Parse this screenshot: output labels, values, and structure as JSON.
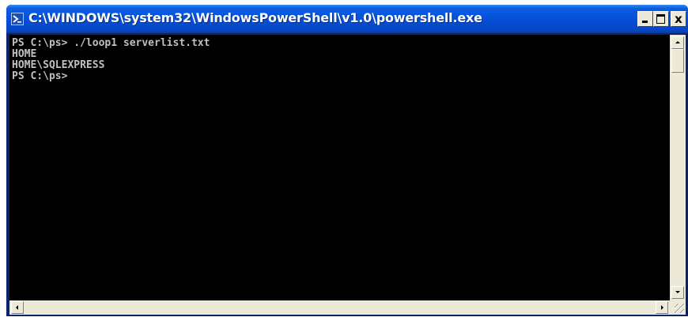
{
  "window": {
    "title": "C:\\WINDOWS\\system32\\WindowsPowerShell\\v1.0\\powershell.exe",
    "controls": {
      "minimize": "",
      "maximize": "",
      "close": "x"
    }
  },
  "console": {
    "background": "#000000",
    "foreground": "#c0c0c0",
    "lines": [
      "PS C:\\ps> ./loop1 serverlist.txt",
      "HOME",
      "HOME\\SQLEXPRESS",
      "PS C:\\ps>"
    ]
  },
  "icons": {
    "title_icon": "powershell-icon",
    "minimize": "minimize-icon",
    "maximize": "maximize-icon",
    "close": "close-icon"
  },
  "colors": {
    "titlebar": "#0550d8",
    "chrome": "#ece9d8"
  }
}
